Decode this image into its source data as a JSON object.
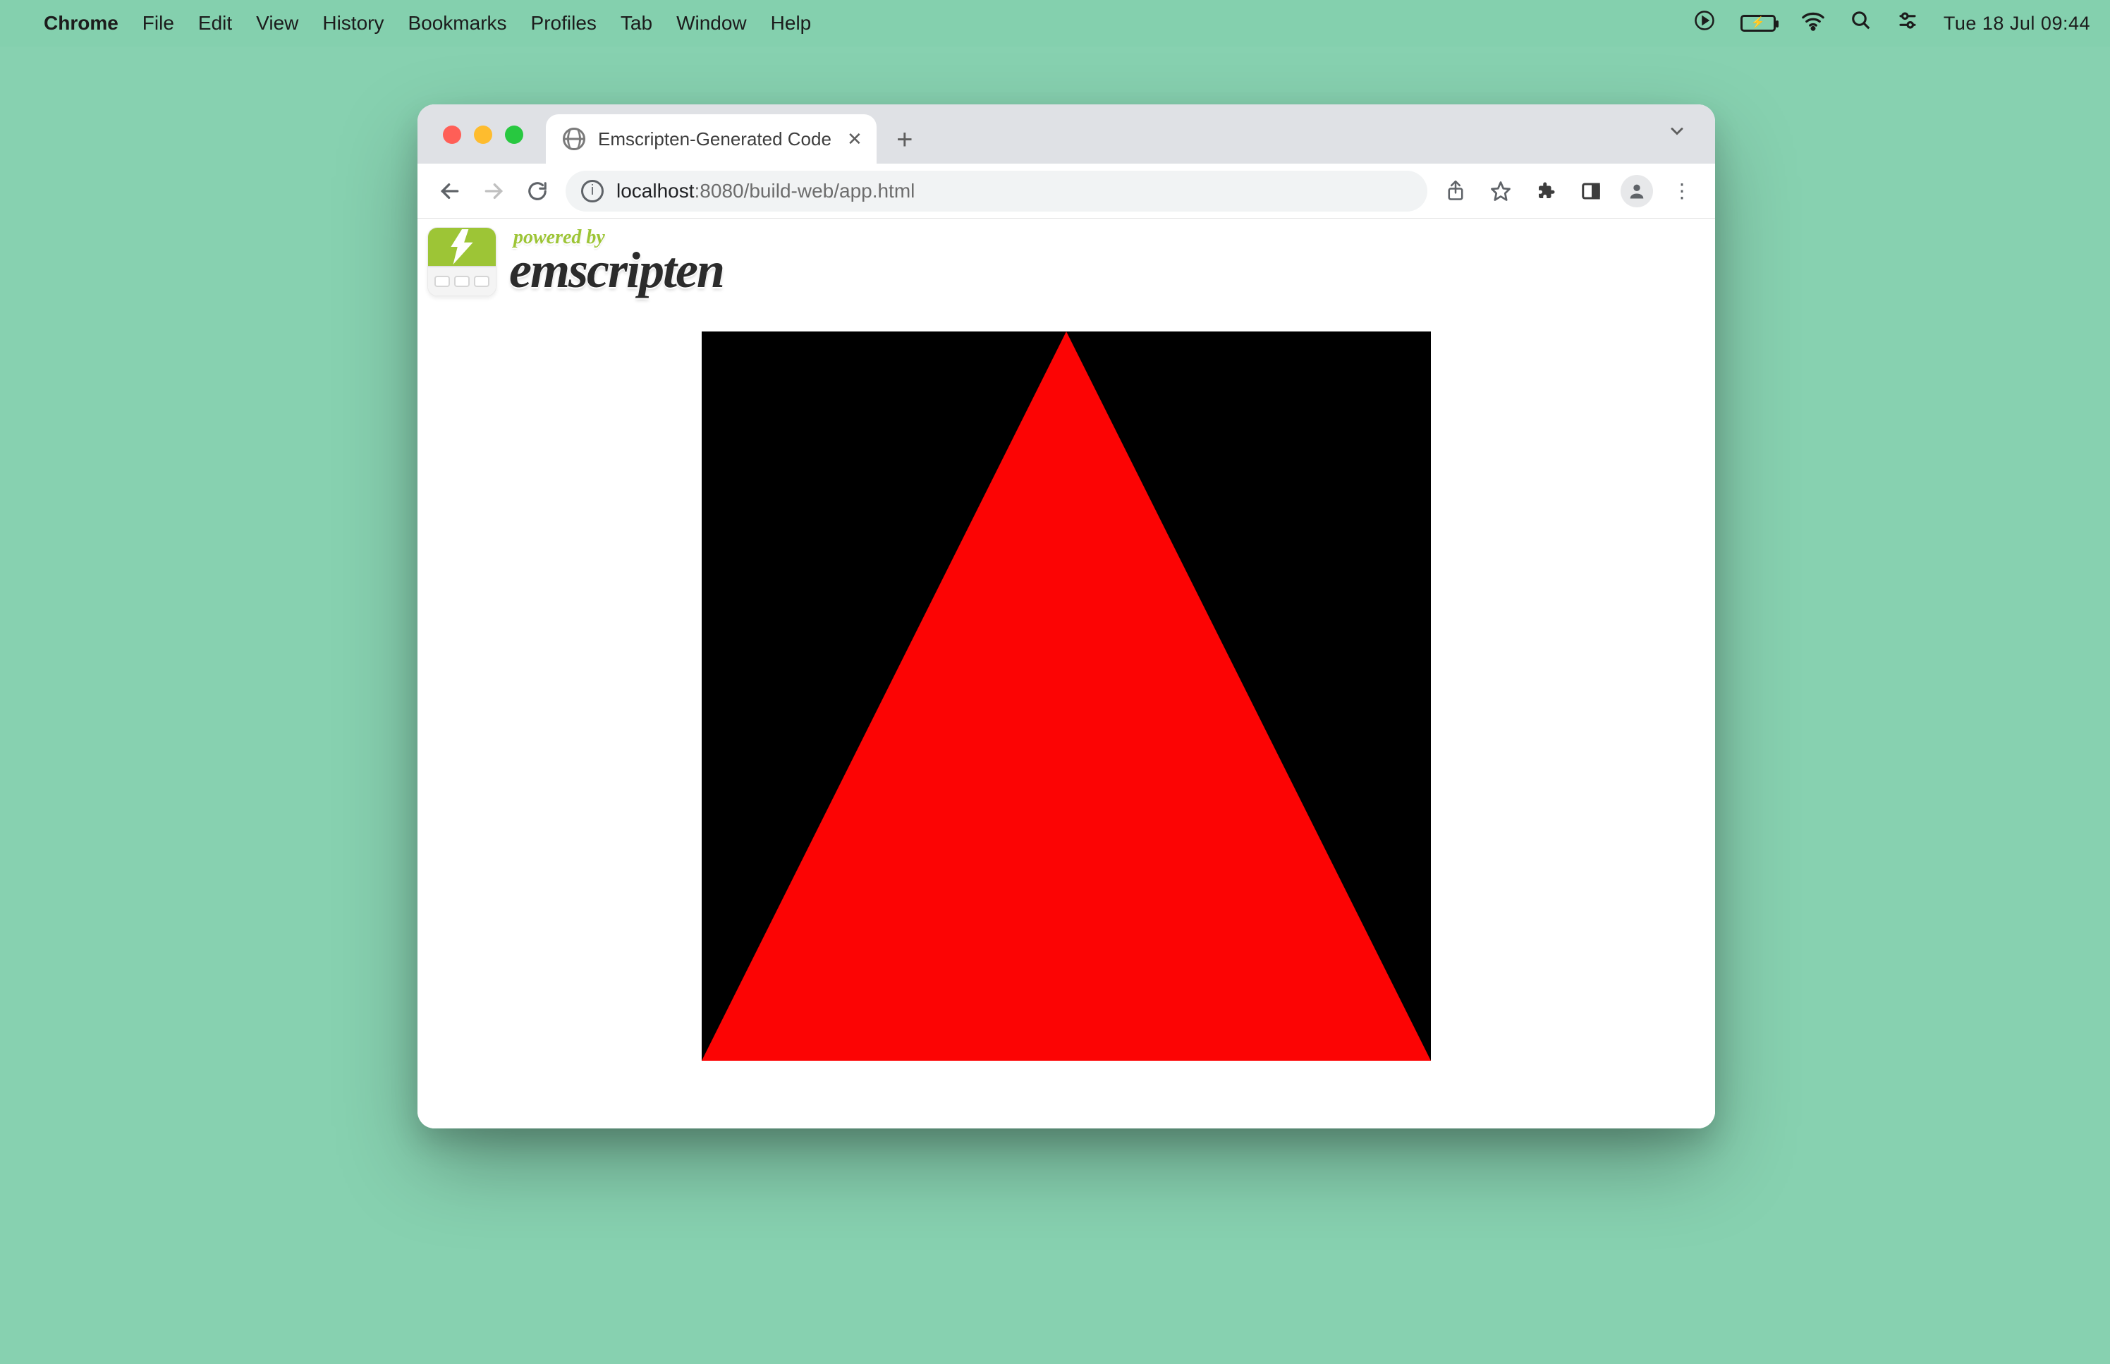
{
  "menubar": {
    "app_name": "Chrome",
    "items": [
      "File",
      "Edit",
      "View",
      "History",
      "Bookmarks",
      "Profiles",
      "Tab",
      "Window",
      "Help"
    ],
    "clock": "Tue 18 Jul  09:44"
  },
  "browser": {
    "tab_title": "Emscripten-Generated Code",
    "url_host": "localhost",
    "url_port_path": ":8080/build-web/app.html"
  },
  "page": {
    "powered_by": "powered by",
    "wordmark": "emscripten"
  },
  "colors": {
    "desktop_bg": "#87d1b0",
    "canvas_bg": "#000000",
    "triangle": "#fc0404",
    "emscripten_green": "#9dc536"
  }
}
